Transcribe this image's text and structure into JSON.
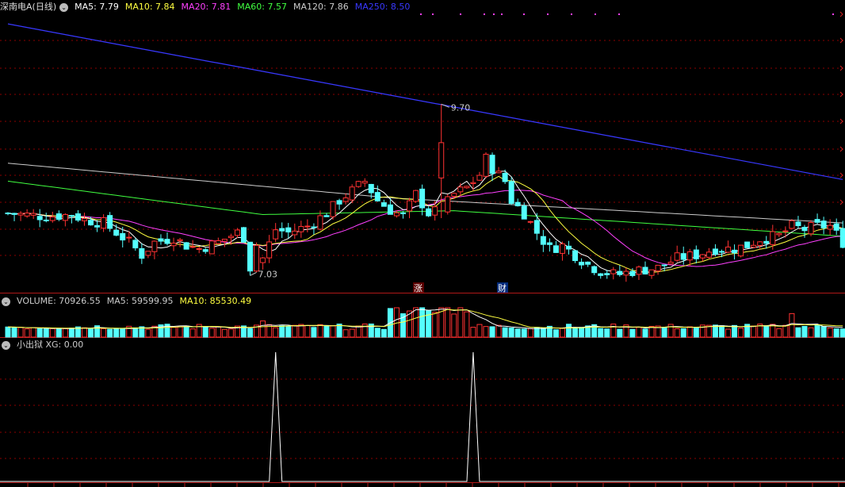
{
  "main_panel": {
    "stock": "深南电A(日线)",
    "ma": [
      {
        "label": "MA5: 7.79",
        "color": "#ffffff"
      },
      {
        "label": "MA10: 7.84",
        "color": "#ffff40"
      },
      {
        "label": "MA20: 7.81",
        "color": "#ff40ff"
      },
      {
        "label": "MA60: 7.57",
        "color": "#40ff40"
      },
      {
        "label": "MA120: 7.86",
        "color": "#cccccc"
      },
      {
        "label": "MA250: 8.50",
        "color": "#3838ff"
      }
    ],
    "high_label": "9.70",
    "low_label": "7.03",
    "marker_zhang": "涨",
    "marker_cai": "财"
  },
  "volume_panel": {
    "labels": [
      {
        "label": "VOLUME: 70926.55",
        "color": "#cccccc"
      },
      {
        "label": "MA5: 59599.95",
        "color": "#cccccc"
      },
      {
        "label": "MA10: 85530.49",
        "color": "#ffff40"
      }
    ]
  },
  "indicator_panel": {
    "labels": [
      {
        "label": "小出狱  XG: 0.00",
        "color": "#cccccc"
      }
    ]
  },
  "colors": {
    "up": "#ff3232",
    "down": "#54ffff",
    "grid": "#8b0000",
    "ma250": "#3838ff",
    "ma120": "#cccccc",
    "ma60": "#40ff40",
    "ma20": "#ff40ff",
    "ma10": "#ffff40",
    "ma5": "#ffffff"
  },
  "chart_data": {
    "type": "candlestick",
    "price_range": [
      6.8,
      11.1
    ],
    "high": 9.7,
    "low": 7.03,
    "signal_peaks_at_candle": [
      43,
      74
    ],
    "signal_range": [
      0,
      1
    ]
  }
}
